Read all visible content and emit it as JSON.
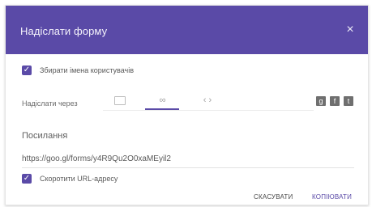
{
  "dialog": {
    "title": "Надіслати форму",
    "close_icon": "×"
  },
  "collect_emails": {
    "label": "Збирати імена користувачів",
    "checked": true
  },
  "send_via": {
    "label": "Надіслати через",
    "tabs": [
      {
        "name": "email",
        "icon": "envelope-icon"
      },
      {
        "name": "link",
        "icon": "link-icon",
        "selected": true
      },
      {
        "name": "embed",
        "icon": "code-icon",
        "glyph": "‹ ›"
      }
    ],
    "share": [
      "google-plus-icon",
      "facebook-icon",
      "twitter-icon"
    ],
    "share_glyphs": [
      "g",
      "f",
      "t"
    ]
  },
  "link": {
    "label": "Посилання",
    "url": "https://goo.gl/forms/y4R9Qu2O0xaMEyil2"
  },
  "shorten_url": {
    "label": "Скоротити URL-адресу",
    "checked": true
  },
  "buttons": {
    "cancel": "СКАСУВАТИ",
    "copy": "КОПІЮВАТИ"
  },
  "colors": {
    "accent": "#5a4aa7"
  }
}
